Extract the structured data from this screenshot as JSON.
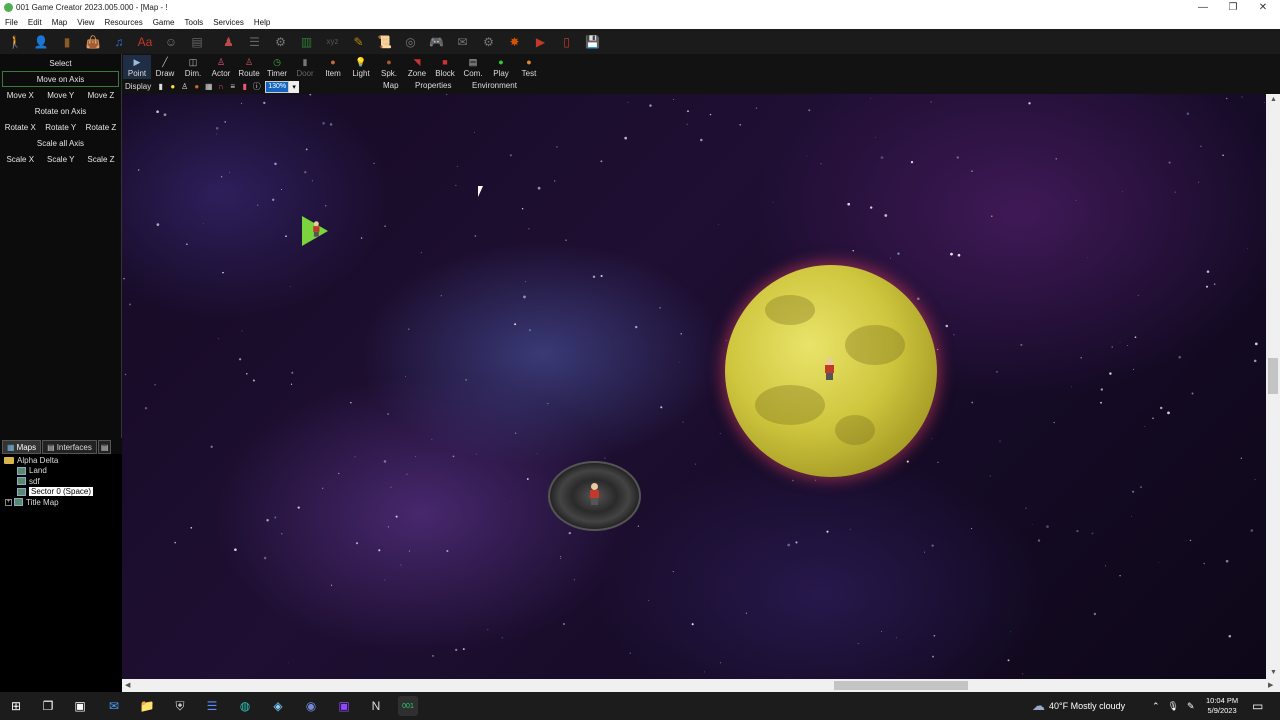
{
  "window": {
    "title": "001 Game Creator 2023.005.000 - [Map - !",
    "controls": {
      "minimize": "—",
      "restore": "❐",
      "close": "✕"
    }
  },
  "menu": [
    "File",
    "Edit",
    "Map",
    "View",
    "Resources",
    "Game",
    "Tools",
    "Services",
    "Help"
  ],
  "toolbar_icons": [
    {
      "name": "actor-editor-icon",
      "glyph": "🚶",
      "color": "#c0392b"
    },
    {
      "name": "character-icon",
      "glyph": "👤",
      "color": "#2e8b57"
    },
    {
      "name": "door-icon",
      "glyph": "▮",
      "color": "#8b5a2b"
    },
    {
      "name": "item-bag-icon",
      "glyph": "👜",
      "color": "#8a5a3a"
    },
    {
      "name": "music-icon",
      "glyph": "♫",
      "color": "#2a6fc9"
    },
    {
      "name": "font-icon",
      "glyph": "Aa",
      "color": "#c0392b"
    },
    {
      "name": "figure-icon",
      "glyph": "☺",
      "color": "#777"
    },
    {
      "name": "database-icon",
      "glyph": "▤",
      "color": "#666"
    },
    {
      "name": "group-icon",
      "glyph": "♟",
      "color": "#c04a4a"
    },
    {
      "name": "list-icon",
      "glyph": "☰",
      "color": "#666"
    },
    {
      "name": "variables-icon",
      "glyph": "⚙",
      "color": "#777"
    },
    {
      "name": "chart-icon",
      "glyph": "▥",
      "color": "#2e7d32"
    },
    {
      "name": "xyz-icon",
      "glyph": "xyz",
      "color": "#555"
    },
    {
      "name": "script-icon",
      "glyph": "✎",
      "color": "#b8860b"
    },
    {
      "name": "scroll-icon",
      "glyph": "📜",
      "color": "#b8860b"
    },
    {
      "name": "stack-icon",
      "glyph": "◎",
      "color": "#777"
    },
    {
      "name": "gamepad-icon",
      "glyph": "🎮",
      "color": "#555"
    },
    {
      "name": "note-icon",
      "glyph": "✉",
      "color": "#777"
    },
    {
      "name": "gear-icon",
      "glyph": "⚙",
      "color": "#777"
    },
    {
      "name": "compile-icon",
      "glyph": "✸",
      "color": "#d35400"
    },
    {
      "name": "media-icon",
      "glyph": "▶",
      "color": "#c0392b"
    },
    {
      "name": "phone-icon",
      "glyph": "▯",
      "color": "#c0392b"
    },
    {
      "name": "save-icon",
      "glyph": "💾",
      "color": "#1565c0"
    }
  ],
  "left_panel": {
    "select": "Select",
    "move_on_axis": "Move on Axis",
    "move": [
      "Move X",
      "Move Y",
      "Move Z"
    ],
    "rotate_on_axis": "Rotate on Axis",
    "rotate": [
      "Rotate X",
      "Rotate Y",
      "Rotate Z"
    ],
    "scale_all_axis": "Scale all Axis",
    "scale": [
      "Scale X",
      "Scale Y",
      "Scale Z"
    ]
  },
  "tabs": {
    "maps": "Maps",
    "interfaces": "Interfaces"
  },
  "tree": {
    "root": "Alpha Delta",
    "children": [
      "Land",
      "sdf",
      "Sector 0 (Space)"
    ],
    "other": "Title Map"
  },
  "modes": [
    {
      "label": "Point",
      "glyph": "▶",
      "color": "#9bd"
    },
    {
      "label": "Draw",
      "glyph": "╱",
      "color": "#bbb"
    },
    {
      "label": "Dim.",
      "glyph": "◫",
      "color": "#bbb"
    },
    {
      "label": "Actor",
      "glyph": "♙",
      "color": "#e57"
    },
    {
      "label": "Route",
      "glyph": "♙",
      "color": "#c55"
    },
    {
      "label": "Timer",
      "glyph": "◷",
      "color": "#4a4"
    },
    {
      "label": "Door",
      "glyph": "▮",
      "color": "#777"
    },
    {
      "label": "Item",
      "glyph": "●",
      "color": "#c63"
    },
    {
      "label": "Light",
      "glyph": "💡",
      "color": "#fd3"
    },
    {
      "label": "Spk.",
      "glyph": "●",
      "color": "#a53"
    },
    {
      "label": "Zone",
      "glyph": "◥",
      "color": "#c33"
    },
    {
      "label": "Block",
      "glyph": "■",
      "color": "#c33"
    },
    {
      "label": "Com.",
      "glyph": "▤",
      "color": "#ccc"
    },
    {
      "label": "Play",
      "glyph": "●",
      "color": "#3c3"
    },
    {
      "label": "Test",
      "glyph": "●",
      "color": "#d83"
    }
  ],
  "display": {
    "label": "Display",
    "zoom": "130%"
  },
  "subtabs": {
    "map": "Map",
    "properties": "Properties",
    "environment": "Environment"
  },
  "taskbar": {
    "weather": "40°F  Mostly cloudy",
    "time": "10:04 PM",
    "date": "5/9/2023",
    "apps": [
      {
        "name": "windows-start-icon",
        "glyph": "⊞",
        "color": "#fff"
      },
      {
        "name": "task-view-icon",
        "glyph": "❐",
        "color": "#fff"
      },
      {
        "name": "app-window-icon",
        "glyph": "▣",
        "color": "#fff"
      },
      {
        "name": "mail-icon",
        "glyph": "✉",
        "color": "#4aa3ff"
      },
      {
        "name": "file-explorer-icon",
        "glyph": "📁",
        "color": "#f1c232"
      },
      {
        "name": "shield-app-icon",
        "glyph": "⛨",
        "color": "#ddd"
      },
      {
        "name": "list-app-icon",
        "glyph": "☰",
        "color": "#5b8cff"
      },
      {
        "name": "edge-browser-icon",
        "glyph": "◍",
        "color": "#2ec4b6"
      },
      {
        "name": "notes-app-icon",
        "glyph": "◈",
        "color": "#7fd0ff"
      },
      {
        "name": "discord-icon",
        "glyph": "◉",
        "color": "#7289da"
      },
      {
        "name": "twitch-icon",
        "glyph": "▣",
        "color": "#9146ff"
      },
      {
        "name": "notion-icon",
        "glyph": "N",
        "color": "#ddd"
      },
      {
        "name": "game-creator-taskbar-icon",
        "glyph": "001",
        "color": "#2ecc71"
      }
    ]
  }
}
